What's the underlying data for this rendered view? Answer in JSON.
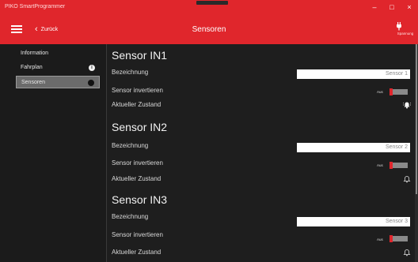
{
  "window": {
    "title": "PIKO SmartProgrammer",
    "minimize": "–",
    "maximize": "□",
    "close": "×"
  },
  "header": {
    "back_label": "Zurück",
    "page_title": "Sensoren",
    "power_label": "Spannung"
  },
  "sidebar": {
    "items": [
      {
        "label": "Information",
        "badge": "",
        "active": false
      },
      {
        "label": "Fahrplan",
        "badge": "i",
        "active": false
      },
      {
        "label": "Sensoren",
        "badge": "",
        "active": true
      }
    ]
  },
  "sensors": [
    {
      "title": "Sensor IN1",
      "name_label": "Bezeichnung",
      "name_value": "Sensor 1",
      "invert_label": "Sensor invertieren",
      "invert_state": "Aus",
      "state_label": "Aktueller Zustand",
      "state_icon": "bell-ringing-icon"
    },
    {
      "title": "Sensor IN2",
      "name_label": "Bezeichnung",
      "name_value": "Sensor 2",
      "invert_label": "Sensor invertieren",
      "invert_state": "Aus",
      "state_label": "Aktueller Zustand",
      "state_icon": "bell-icon"
    },
    {
      "title": "Sensor IN3",
      "name_label": "Bezeichnung",
      "name_value": "Sensor 3",
      "invert_label": "Sensor invertieren",
      "invert_state": "Aus",
      "state_label": "Aktueller Zustand",
      "state_icon": "bell-icon"
    }
  ],
  "colors": {
    "accent": "#e0262c",
    "background": "#1e1e1e",
    "sidebar": "#1b1b1b",
    "active_item": "#6b6b6b"
  }
}
